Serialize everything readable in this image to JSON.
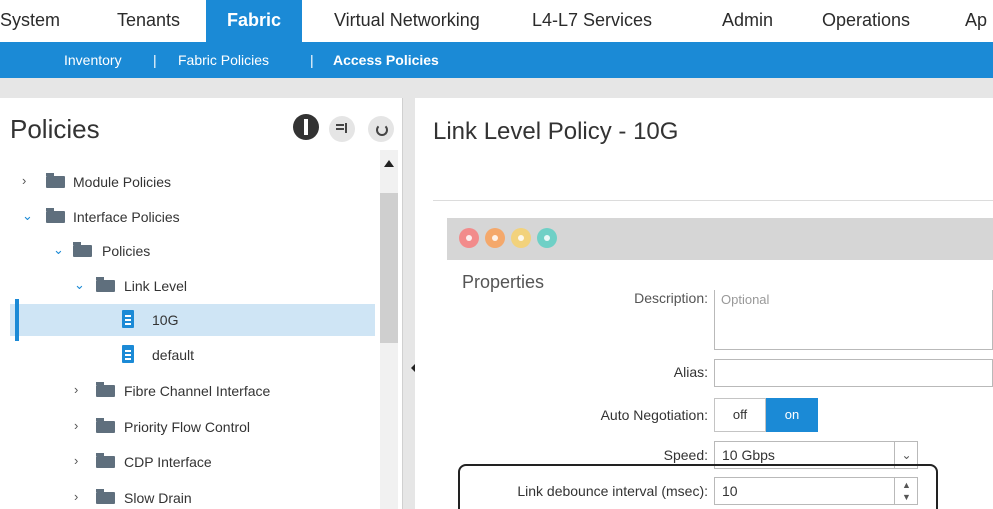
{
  "topnav": {
    "tabs": [
      {
        "label": "System"
      },
      {
        "label": "Tenants"
      },
      {
        "label": "Fabric"
      },
      {
        "label": "Virtual Networking"
      },
      {
        "label": "L4-L7 Services"
      },
      {
        "label": "Admin"
      },
      {
        "label": "Operations"
      },
      {
        "label": "Ap"
      }
    ],
    "active_tab": "Fabric"
  },
  "subnav": {
    "items": [
      {
        "label": "Inventory"
      },
      {
        "label": "Fabric Policies"
      },
      {
        "label": "Access Policies"
      }
    ],
    "separator": "|",
    "active_item": "Access Policies"
  },
  "left_pane": {
    "title": "Policies",
    "tree": [
      {
        "label": "Module Policies",
        "expanded": false,
        "icon": "folder-icon"
      },
      {
        "label": "Interface Policies",
        "expanded": true,
        "icon": "folder-icon"
      },
      {
        "label": "Policies",
        "expanded": true,
        "icon": "folder-icon"
      },
      {
        "label": "Link Level",
        "expanded": true,
        "icon": "folder-icon"
      },
      {
        "label": "10G",
        "selected": true,
        "icon": "policy-doc-icon"
      },
      {
        "label": "default",
        "icon": "policy-doc-icon"
      },
      {
        "label": "Fibre Channel Interface",
        "expanded": false,
        "icon": "folder-icon"
      },
      {
        "label": "Priority Flow Control",
        "expanded": false,
        "icon": "folder-icon"
      },
      {
        "label": "CDP Interface",
        "expanded": false,
        "icon": "folder-icon"
      },
      {
        "label": "Slow Drain",
        "expanded": false,
        "icon": "folder-icon"
      }
    ]
  },
  "right_pane": {
    "title": "Link Level Policy - 10G",
    "properties_heading": "Properties",
    "description": {
      "label": "Description:",
      "placeholder": "Optional",
      "value": ""
    },
    "alias": {
      "label": "Alias:",
      "value": ""
    },
    "auto_negotiation": {
      "label": "Auto Negotiation:",
      "off_label": "off",
      "on_label": "on",
      "value": "on"
    },
    "speed": {
      "label": "Speed:",
      "value": "10 Gbps"
    },
    "link_debounce": {
      "label": "Link debounce interval (msec):",
      "value": "10"
    }
  },
  "colors": {
    "accent": "#1b8ad6",
    "selected_row": "#cfe5f5",
    "fault_critical": "#f28b8b",
    "fault_major": "#f4a86b",
    "fault_minor": "#f2d27c",
    "fault_warning": "#6fd0c6"
  }
}
